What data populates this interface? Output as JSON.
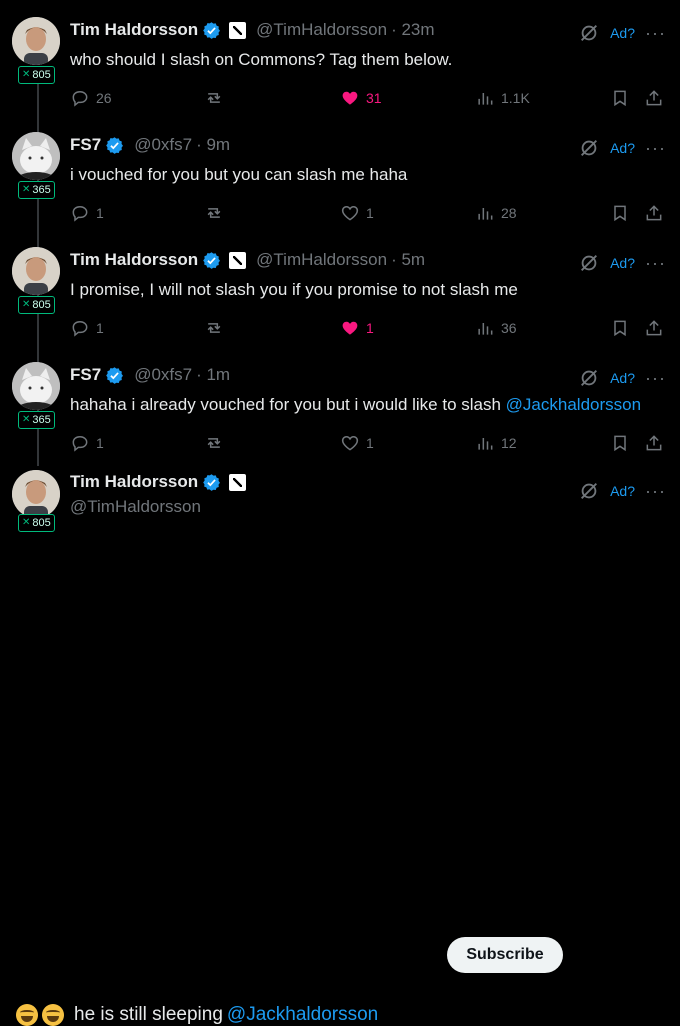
{
  "tweets": [
    {
      "name": "Tim Haldorsson",
      "handle": "@TimHaldorsson",
      "time": "· 23m",
      "badge": "805",
      "text": "who should I slash on Commons? Tag them below.",
      "mention": "",
      "ad": "Ad?",
      "replies": "26",
      "likes": "31",
      "liked": true,
      "views": "1.1K",
      "avatar": "man"
    },
    {
      "name": "FS7",
      "handle": "@0xfs7",
      "time": "· 9m",
      "badge": "365",
      "text": "i vouched for you but you can slash me haha",
      "mention": "",
      "ad": "Ad?",
      "replies": "1",
      "likes": "1",
      "liked": false,
      "views": "28",
      "avatar": "cat"
    },
    {
      "name": "Tim Haldorsson",
      "handle": "@TimHaldorsson",
      "time": "· 5m",
      "badge": "805",
      "text": "I promise, I will not slash you if you promise to not slash me",
      "mention": "",
      "ad": "Ad?",
      "replies": "1",
      "likes": "1",
      "liked": true,
      "views": "36",
      "avatar": "man"
    },
    {
      "name": "FS7",
      "handle": "@0xfs7",
      "time": "· 1m",
      "badge": "365",
      "text": "hahaha i already vouched for you but i would like to slash ",
      "mention": "@Jackhaldorsson",
      "ad": "Ad?",
      "replies": "1",
      "likes": "1",
      "liked": false,
      "views": "12",
      "avatar": "cat"
    }
  ],
  "final": {
    "name": "Tim Haldorsson",
    "handle": "@TimHaldorsson",
    "badge": "805",
    "subscribe_label": "Subscribe",
    "ad": "Ad?",
    "text": "he is still sleeping ",
    "mention": "@Jackhaldorsson",
    "emojis": [
      "face-with-tears-of-joy",
      "face-with-tears-of-joy"
    ]
  },
  "colors": {
    "accent": "#1d9bf0",
    "like": "#f91880",
    "muted": "#71767b",
    "badge_green": "#00ba7c"
  }
}
